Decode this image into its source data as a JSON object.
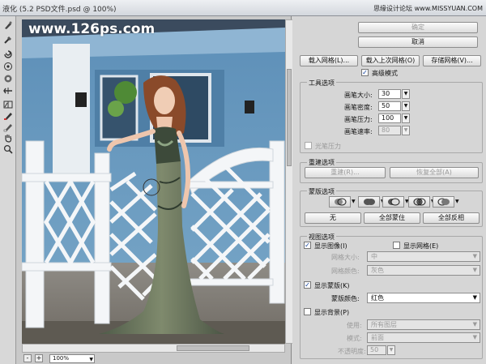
{
  "window": {
    "title": "液化 (5.2 PSD文件.psd @ 100%)",
    "watermark": "思缘设计论坛 www.MISSYUAN.COM"
  },
  "photo": {
    "watermark": "www.126ps.com"
  },
  "tools": [
    "warp-icon",
    "reconstruct-icon",
    "twirl-icon",
    "pucker-icon",
    "bloat-icon",
    "push-left-icon",
    "mirror-icon",
    "freeze-mask-icon",
    "thaw-mask-icon",
    "hand-icon",
    "zoom-icon"
  ],
  "status": {
    "zoom_minus": "-",
    "zoom_plus": "+",
    "zoom_value": "100%"
  },
  "buttons": {
    "ok": "确定",
    "cancel": "取消",
    "load_mesh": "载入网格(L)...",
    "load_last_mesh": "载入上次网格(O)",
    "save_mesh": "存储网格(V)..."
  },
  "advanced_mode": {
    "label": "高级模式",
    "checked": true
  },
  "tool_options": {
    "title": "工具选项",
    "brush_size": {
      "label": "画笔大小:",
      "value": "30"
    },
    "brush_density": {
      "label": "画笔密度:",
      "value": "50"
    },
    "brush_pressure": {
      "label": "画笔压力:",
      "value": "100"
    },
    "brush_rate": {
      "label": "画笔速率:",
      "value": "80"
    },
    "stylus_pressure": {
      "label": "光笔压力",
      "checked": false
    }
  },
  "reconstruct_options": {
    "title": "重建选项",
    "reconstruct": "重建(R)...",
    "restore_all": "恢复全部(A)"
  },
  "mask_options": {
    "title": "蒙版选项",
    "none": "无",
    "mask_all": "全部蒙住",
    "invert_all": "全部反相"
  },
  "view_options": {
    "title": "视图选项",
    "show_image": {
      "label": "显示图像(I)",
      "checked": true
    },
    "show_mesh": {
      "label": "显示网格(E)",
      "checked": false
    },
    "mesh_size": {
      "label": "网格大小:",
      "value": "中"
    },
    "mesh_color": {
      "label": "网格颜色:",
      "value": "灰色"
    },
    "show_mask": {
      "label": "显示蒙版(K)",
      "checked": true
    },
    "mask_color": {
      "label": "蒙版颜色:",
      "value": "红色"
    },
    "show_backdrop": {
      "label": "显示背景(P)",
      "checked": false
    },
    "use": {
      "label": "使用:",
      "value": "所有图层"
    },
    "mode": {
      "label": "模式:",
      "value": "前面"
    },
    "opacity": {
      "label": "不透明度:",
      "value": "50"
    }
  },
  "colors": {
    "accent": "#0a3c9a",
    "panel": "#d6d6d6"
  }
}
